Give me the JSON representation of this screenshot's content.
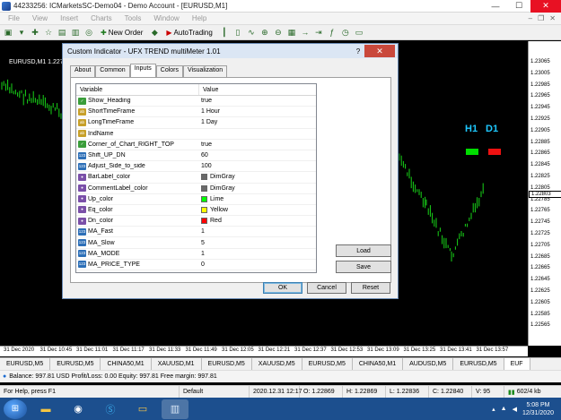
{
  "window": {
    "title": "44233256: ICMarketsSC-Demo04 - Demo Account - [EURUSD,M1]",
    "minimize": "—",
    "maximize": "☐",
    "close": "✕"
  },
  "menu": [
    "File",
    "View",
    "Insert",
    "Charts",
    "Tools",
    "Window",
    "Help"
  ],
  "toolbar": {
    "new_order": "New Order",
    "autotrading": "AutoTrading"
  },
  "chart": {
    "symbol_label": "EURUSD,M1  1.2279",
    "price_ticks": [
      "1.23065",
      "1.23005",
      "1.22985",
      "1.22965",
      "1.22945",
      "1.22925",
      "1.22905",
      "1.22885",
      "1.22865",
      "1.22845",
      "1.22825",
      "1.22805",
      "1.22785",
      "1.22765",
      "1.22745",
      "1.22725",
      "1.22705",
      "1.22685",
      "1.22665",
      "1.22645",
      "1.22625",
      "1.22605",
      "1.22585",
      "1.22565"
    ],
    "current_price": "1.22803",
    "time_ticks": [
      "31 Dec 2020",
      "31 Dec 10:45",
      "31 Dec 11:01",
      "31 Dec 11:17",
      "31 Dec 11:33",
      "31 Dec 11:49",
      "31 Dec 12:05",
      "31 Dec 12:21",
      "31 Dec 12:37",
      "31 Dec 12:53",
      "31 Dec 13:09",
      "31 Dec 13:25",
      "31 Dec 13:41",
      "31 Dec 13:57"
    ],
    "indicator": {
      "h1_label": "H1",
      "d1_label": "D1",
      "h1_color": "#00dd00",
      "d1_color": "#ee1111"
    }
  },
  "dialog": {
    "title": "Custom Indicator - UFX TREND multiMeter 1.01",
    "help": "?",
    "close": "✕",
    "tabs": [
      "About",
      "Common",
      "Inputs",
      "Colors",
      "Visualization"
    ],
    "active_tab": "Inputs",
    "col_variable": "Variable",
    "col_value": "Value",
    "rows": [
      {
        "type": "bool",
        "icon_text": "✓",
        "name": "Show_Heading",
        "value": "true"
      },
      {
        "type": "str",
        "icon_text": "ab",
        "name": "ShortTimeFrame",
        "value": "1 Hour"
      },
      {
        "type": "str",
        "icon_text": "ab",
        "name": "LongTimeFrame",
        "value": "1 Day"
      },
      {
        "type": "str",
        "icon_text": "ab",
        "name": "IndName",
        "value": ""
      },
      {
        "type": "bool",
        "icon_text": "✓",
        "name": "Corner_of_Chart_RIGHT_TOP",
        "value": "true"
      },
      {
        "type": "int",
        "icon_text": "123",
        "name": "Shift_UP_DN",
        "value": "60"
      },
      {
        "type": "int",
        "icon_text": "123",
        "name": "Adjust_Side_to_side",
        "value": "100"
      },
      {
        "type": "color",
        "icon_text": "●",
        "name": "BarLabel_color",
        "value": "DimGray",
        "swatch": "#696969"
      },
      {
        "type": "color",
        "icon_text": "●",
        "name": "CommentLabel_color",
        "value": "DimGray",
        "swatch": "#696969"
      },
      {
        "type": "color",
        "icon_text": "●",
        "name": "Up_color",
        "value": "Lime",
        "swatch": "#00ff00"
      },
      {
        "type": "color",
        "icon_text": "●",
        "name": "Eq_color",
        "value": "Yellow",
        "swatch": "#ffff00"
      },
      {
        "type": "color",
        "icon_text": "●",
        "name": "Dn_color",
        "value": "Red",
        "swatch": "#ff0000"
      },
      {
        "type": "int",
        "icon_text": "123",
        "name": "MA_Fast",
        "value": "1"
      },
      {
        "type": "int",
        "icon_text": "123",
        "name": "MA_Slow",
        "value": "5"
      },
      {
        "type": "int",
        "icon_text": "123",
        "name": "MA_MODE",
        "value": "1"
      },
      {
        "type": "int",
        "icon_text": "123",
        "name": "MA_PRICE_TYPE",
        "value": "0"
      }
    ],
    "load": "Load",
    "save": "Save",
    "ok": "OK",
    "cancel": "Cancel",
    "reset": "Reset"
  },
  "symbol_tabs": [
    "EURUSD,M5",
    "EURUSD,M5",
    "CHINA50,M1",
    "XAUUSD,M1",
    "EURUSD,M5",
    "XAUUSD,M5",
    "EURUSD,M5",
    "CHINA50,M1",
    "AUDUSD,M5",
    "EURUSD,M5",
    "EUF"
  ],
  "account": "Balance: 997.81 USD  Profit/Loss: 0.00  Equity: 997.81  Free margin: 997.81",
  "status": {
    "help": "For Help, press F1",
    "profile": "Default",
    "datetime": "2020.12.31 12:17",
    "open": "O: 1.22869",
    "high": "H: 1.22869",
    "low": "L: 1.22836",
    "close": "C: 1.22840",
    "volume": "V: 95",
    "traffic": "602/4 kb"
  },
  "taskbar": {
    "time": "5:08 PM",
    "date": "12/31/2020"
  }
}
